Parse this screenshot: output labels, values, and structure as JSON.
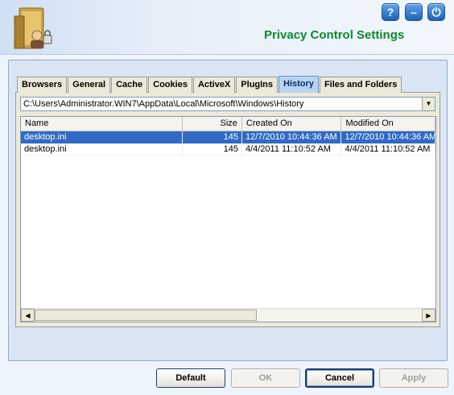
{
  "window": {
    "title": "Privacy Control Settings",
    "header_buttons": [
      {
        "name": "help-icon",
        "glyph": "?"
      },
      {
        "name": "minimize-icon",
        "glyph": "–"
      },
      {
        "name": "power-icon",
        "glyph": "⏻"
      }
    ]
  },
  "tabs": [
    {
      "label": "Browsers",
      "active": false
    },
    {
      "label": "General",
      "active": false
    },
    {
      "label": "Cache",
      "active": false
    },
    {
      "label": "Cookies",
      "active": false
    },
    {
      "label": "ActiveX",
      "active": false
    },
    {
      "label": "PlugIns",
      "active": false
    },
    {
      "label": "History",
      "active": true
    },
    {
      "label": "Files and Folders",
      "active": false
    }
  ],
  "path": {
    "value": "C:\\Users\\Administrator.WIN7\\AppData\\Local\\Microsoft\\Windows\\History"
  },
  "table": {
    "columns": [
      "Name",
      "Size",
      "Created On",
      "Modified On"
    ],
    "rows": [
      {
        "name": "desktop.ini",
        "size": "145",
        "created": "12/7/2010 10:44:36 AM",
        "modified": "12/7/2010 10:44:36 AM",
        "selected": true
      },
      {
        "name": "desktop.ini",
        "size": "145",
        "created": "4/4/2011 11:10:52 AM",
        "modified": "4/4/2011 11:10:52 AM",
        "selected": false
      }
    ]
  },
  "buttons": {
    "default": "Default",
    "ok": "OK",
    "cancel": "Cancel",
    "apply": "Apply"
  },
  "colors": {
    "title": "#0c8a2c",
    "selection": "#316ac5",
    "active_tab": "#b8d4f4"
  }
}
